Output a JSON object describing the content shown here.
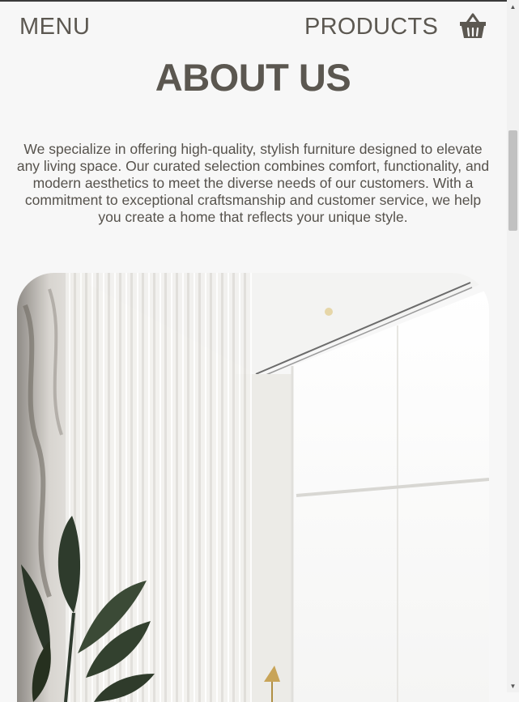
{
  "nav": {
    "menu_label": "MENU",
    "products_label": "PRODUCTS",
    "cart_icon": "basket-icon"
  },
  "about": {
    "title": "ABOUT US",
    "body": "We specialize in offering high-quality, stylish furniture designed to elevate any living space. Our curated selection combines comfort, functionality, and modern aesthetics to meet the diverse needs of our customers. With a commitment to exceptional craftsmanship and customer service, we help you create a home that reflects your unique style."
  },
  "colors": {
    "text": "#5b5750",
    "background": "#f7f7f7"
  }
}
